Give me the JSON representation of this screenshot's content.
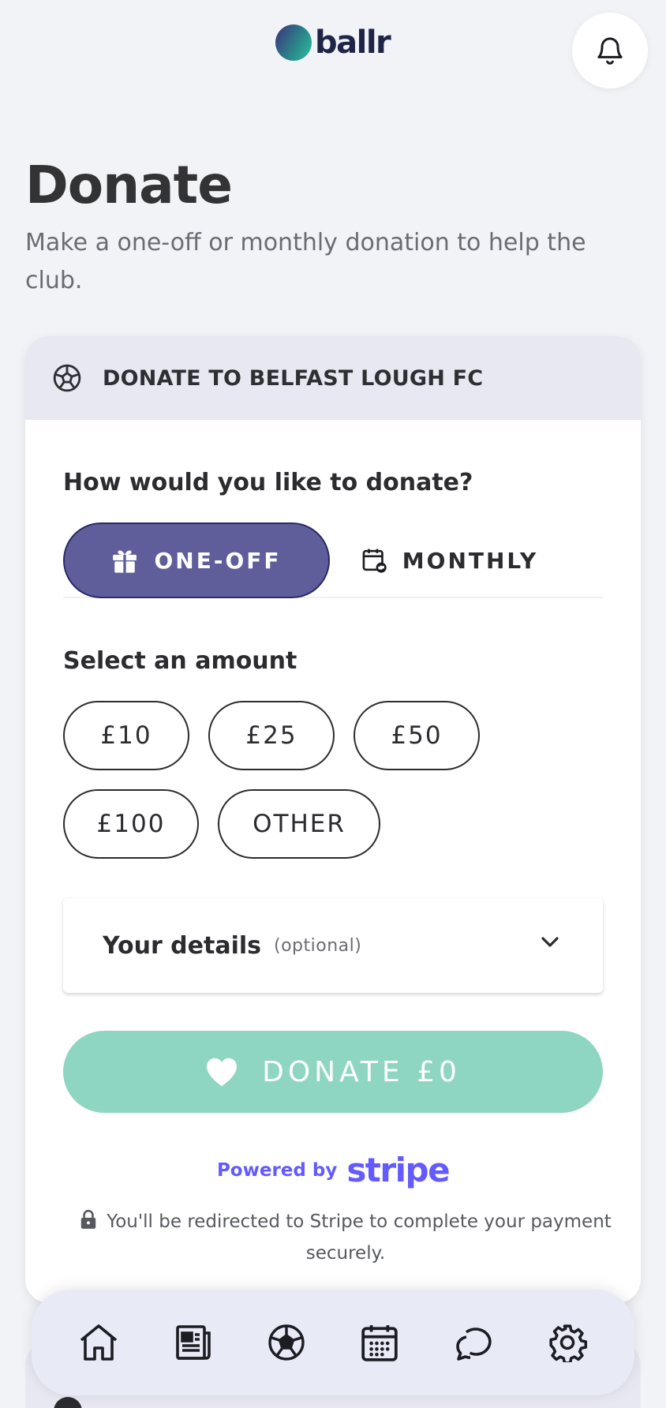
{
  "header": {
    "logo_text": "ballr",
    "bell_icon": "bell-icon"
  },
  "page": {
    "title": "Donate",
    "subtitle": "Make a one-off or monthly donation to help the club."
  },
  "card": {
    "header_icon": "football-icon",
    "header_title": "DONATE TO BELFAST LOUGH FC",
    "question": "How would you like to donate?",
    "frequency": {
      "selected": "ONE-OFF",
      "options": [
        {
          "label": "ONE-OFF",
          "icon": "gift-icon"
        },
        {
          "label": "MONTHLY",
          "icon": "calendar-repeat-icon"
        }
      ]
    },
    "amount_label": "Select an amount",
    "amounts": [
      "£10",
      "£25",
      "£50",
      "£100",
      "OTHER"
    ],
    "details": {
      "title": "Your details",
      "optional": "(optional)",
      "icon": "chevron-down-icon"
    },
    "donate_button": {
      "label": "DONATE £0",
      "icon": "heart-icon"
    },
    "powered_by": "Powered by",
    "stripe_brand": "stripe",
    "secure_note": "You'll be redirected to Stripe to complete your payment securely."
  },
  "bottom_nav": [
    {
      "name": "home-icon"
    },
    {
      "name": "news-icon"
    },
    {
      "name": "football-icon"
    },
    {
      "name": "calendar-icon"
    },
    {
      "name": "chat-icon"
    },
    {
      "name": "settings-icon"
    }
  ],
  "colors": {
    "primary": "#5f5e9b",
    "donate": "#8fd6c2",
    "stripe": "#635bff",
    "background": "#f2f3f7"
  }
}
